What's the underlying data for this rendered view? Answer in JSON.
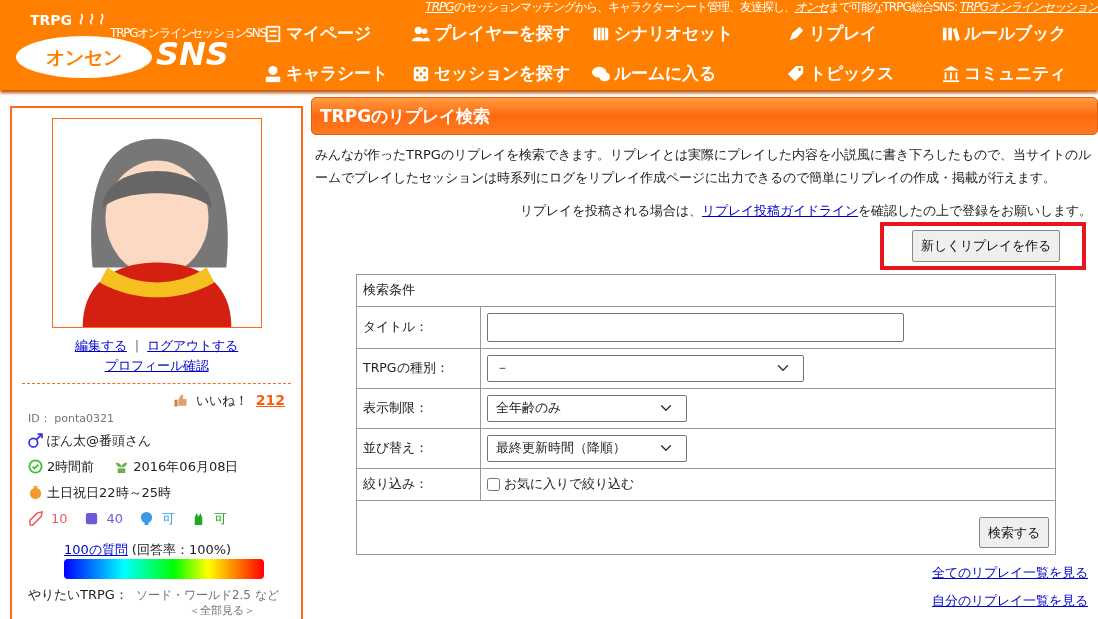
{
  "header": {
    "tagline_parts": [
      {
        "text": "TRPG",
        "kind": "em"
      },
      {
        "text": "のセッションマッチングから、キャラクターシート管理、友達探し、",
        "kind": "plain"
      },
      {
        "text": "オンセ",
        "kind": "em"
      },
      {
        "text": "まで可能なTRPG総合SNS: ",
        "kind": "plain"
      },
      {
        "text": "TRPGオンラインセッション",
        "kind": "em"
      }
    ],
    "logo": {
      "top": "TRPG",
      "main": "オンセン",
      "sns": "SNS",
      "sub": "TRPGオンラインセッションSNS"
    },
    "nav": [
      {
        "label": "マイページ"
      },
      {
        "label": "プレイヤーを探す"
      },
      {
        "label": "シナリオセット"
      },
      {
        "label": "リプレイ"
      },
      {
        "label": "ルールブック"
      },
      {
        "label": "キャラシート"
      },
      {
        "label": "セッションを探す"
      },
      {
        "label": "ルームに入る"
      },
      {
        "label": "トピックス"
      },
      {
        "label": "コミュニティ"
      }
    ]
  },
  "profile": {
    "links": [
      "編集する",
      "ログアウトする"
    ],
    "separator": "|",
    "profile_link": "プロフィール確認",
    "like_label": "いいね！",
    "like_count": "212",
    "id_text": "ID： ponta0321",
    "name": "ぽん太@番頭さん",
    "last_login": "2時間前",
    "joined": "2016年06月08日",
    "play_time": "土日祝日22時～25時",
    "stats": [
      {
        "value": "10",
        "color": "#f05a5a"
      },
      {
        "value": "40",
        "color": "#6a5ad8"
      },
      {
        "value": "可",
        "color": "#3a9be8"
      },
      {
        "value": "可",
        "color": "#22a822"
      }
    ],
    "questions_link": "100の質問",
    "answer_rate": "(回答率：100%)",
    "want_label": "やりたいTRPG：",
    "want_value": "ソード・ワールド2.5 など",
    "want_more": "＜全部見る＞"
  },
  "main": {
    "title": "TRPGのリプレイ検索",
    "description": "みんなが作ったTRPGのリプレイを検索できます。リプレイとは実際にプレイした内容を小説風に書き下ろしたもので、当サイトのルームでプレイしたセッションは時系列にログをリプレイ作成ページに出力できるので簡単にリプレイの作成・掲載が行えます。",
    "guide_prefix": "リプレイを投稿される場合は、",
    "guide_link": "リプレイ投稿ガイドライン",
    "guide_suffix": "を確認したの上で登録をお願いします。",
    "new_button": "新しくリプレイを作る",
    "new_button_highlighted": true,
    "form": {
      "heading": "検索条件",
      "rows": [
        {
          "label": "タイトル：",
          "kind": "text"
        },
        {
          "label": "TRPGの種別：",
          "kind": "select",
          "value": "－",
          "wide": true
        },
        {
          "label": "表示制限：",
          "kind": "select",
          "value": "全年齢のみ",
          "wide": false
        },
        {
          "label": "並び替え：",
          "kind": "select",
          "value": "最終更新時間（降順）",
          "wide": false
        },
        {
          "label": "絞り込み：",
          "kind": "checkbox",
          "text": "お気に入りで絞り込む",
          "checked": false
        }
      ],
      "submit": "検索する"
    },
    "links": [
      "全てのリプレイ一覧を見る",
      "自分のリプレイ一覧を見る"
    ]
  }
}
